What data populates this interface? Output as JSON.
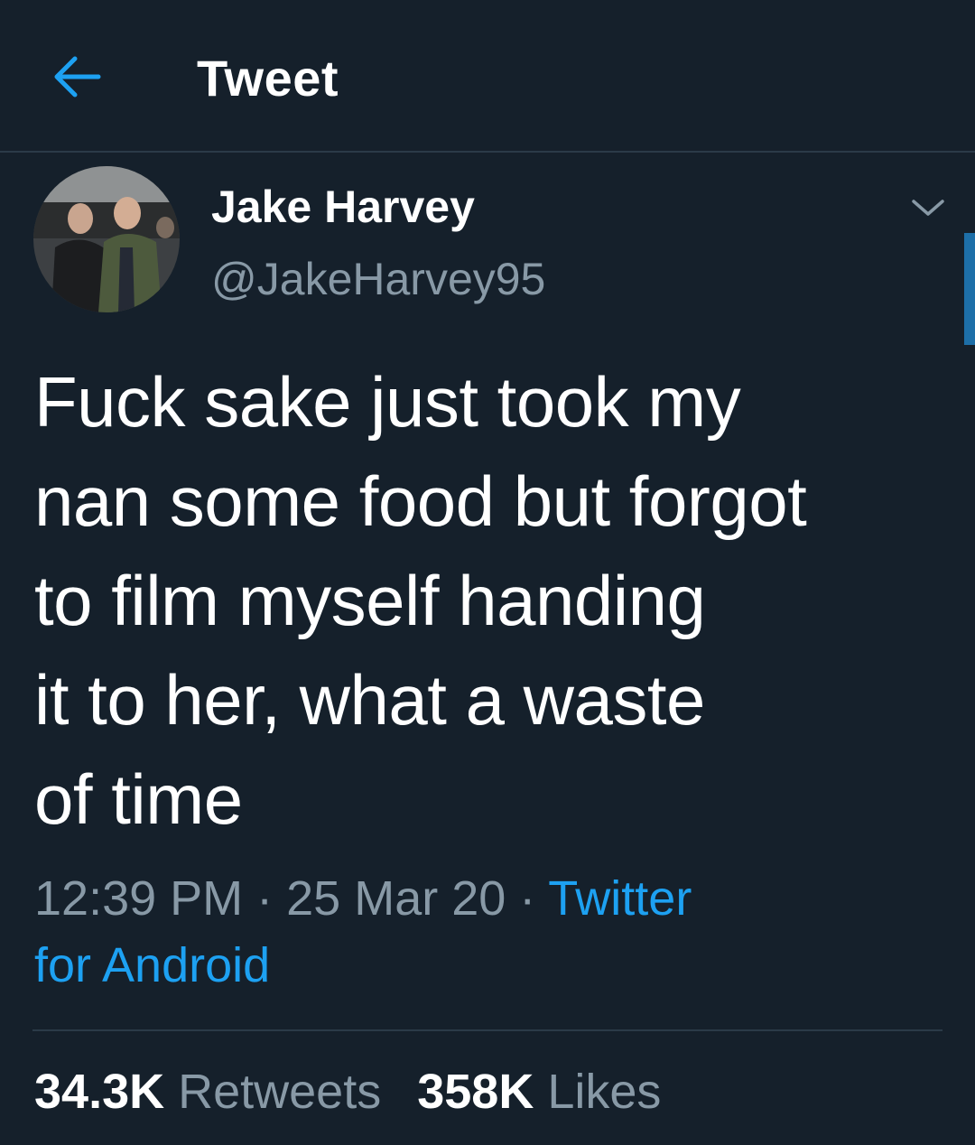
{
  "header": {
    "back_icon": "arrow-left-icon",
    "title": "Tweet"
  },
  "author": {
    "name": "Jake Harvey",
    "handle": "@JakeHarvey95",
    "menu_icon": "chevron-down-icon"
  },
  "tweet": {
    "lines": [
      "Fuck sake just took my",
      "nan some food but forgot",
      "to film myself handing",
      "it to her, what a waste",
      "of time"
    ],
    "time": "12:39 PM",
    "date": "25 Mar 20",
    "source_line1": "Twitter",
    "source_line2": "for Android"
  },
  "stats": {
    "retweets_count": "34.3K",
    "retweets_label": "Retweets",
    "likes_count": "358K",
    "likes_label": "Likes"
  },
  "colors": {
    "background": "#15202b",
    "accent": "#1da1f2",
    "secondary_text": "#8899a6",
    "divider": "#2b3a48"
  }
}
